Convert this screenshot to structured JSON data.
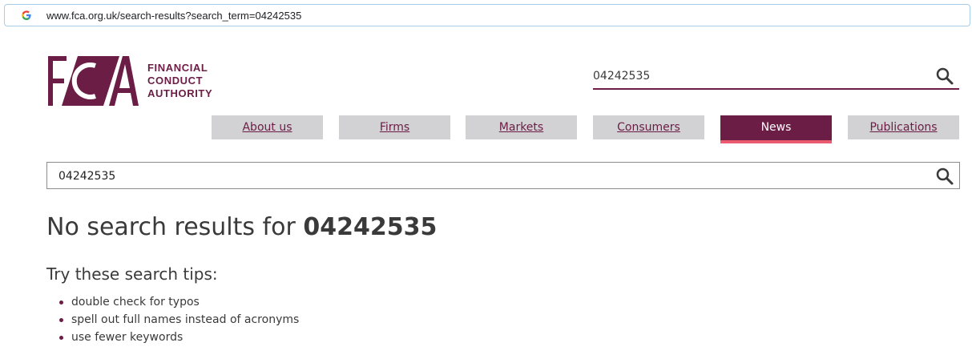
{
  "browser": {
    "url": "www.fca.org.uk/search-results?search_term=04242535",
    "favicon": "google-g-icon"
  },
  "logo": {
    "letters": "FCA",
    "line1": "FINANCIAL",
    "line2": "CONDUCT",
    "line3": "AUTHORITY"
  },
  "header_search": {
    "value": "04242535",
    "icon": "search-icon"
  },
  "nav": {
    "items": [
      {
        "label": "About us",
        "active": false
      },
      {
        "label": "Firms",
        "active": false
      },
      {
        "label": "Markets",
        "active": false
      },
      {
        "label": "Consumers",
        "active": false
      },
      {
        "label": "News",
        "active": true
      },
      {
        "label": "Publications",
        "active": false
      }
    ]
  },
  "main_search": {
    "value": "04242535",
    "icon": "search-icon"
  },
  "results": {
    "heading_prefix": "No search results for",
    "search_term": "04242535"
  },
  "tips": {
    "heading": "Try these search tips:",
    "items": [
      "double check for typos",
      "spell out full names instead of acronyms",
      "use fewer keywords"
    ]
  },
  "colors": {
    "brand": "#6b1d45",
    "nav_inactive_bg": "#d2d1d3",
    "active_underline": "#ea5b70",
    "text": "#3a3a3a"
  }
}
